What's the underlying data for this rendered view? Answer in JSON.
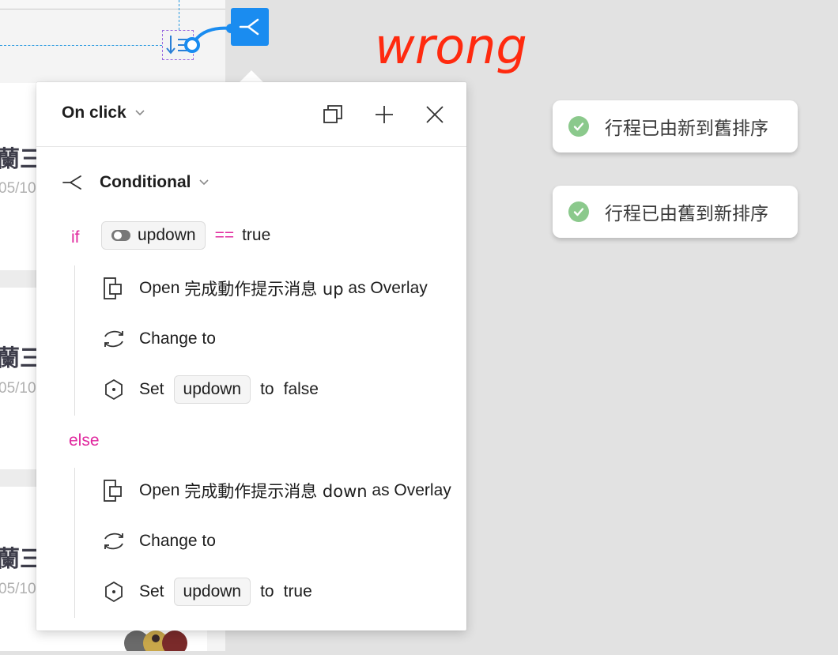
{
  "background": {
    "cards": [
      {
        "title": "蘭三",
        "date": "05/10"
      },
      {
        "title": "蘭三",
        "date": "05/10"
      },
      {
        "title": "蘭三",
        "date": "05/10"
      }
    ]
  },
  "annotation": {
    "text": "wrong",
    "color": "#ff2a0f"
  },
  "toasts": [
    {
      "icon": "check-circle-icon",
      "message": "行程已由新到舊排序"
    },
    {
      "icon": "check-circle-icon",
      "message": "行程已由舊到新排序"
    }
  ],
  "panel": {
    "trigger": "On click",
    "header_icons": [
      "duplicate-icon",
      "plus-icon",
      "close-icon"
    ],
    "conditional_label": "Conditional",
    "if_keyword": "if",
    "condition": {
      "variable": "updown",
      "operator": "==",
      "value": "true"
    },
    "if_actions": [
      {
        "icon": "overlay-icon",
        "verb": "Open",
        "target": "完成動作提示消息 up",
        "suffix": "as Overlay"
      },
      {
        "icon": "change-to-icon",
        "verb": "Change to"
      },
      {
        "icon": "variable-icon",
        "verb": "Set",
        "variable": "updown",
        "mid": "to",
        "value": "false"
      }
    ],
    "else_keyword": "else",
    "else_actions": [
      {
        "icon": "overlay-icon",
        "verb": "Open",
        "target": "完成動作提示消息 down",
        "suffix": "as Overlay"
      },
      {
        "icon": "change-to-icon",
        "verb": "Change to"
      },
      {
        "icon": "variable-icon",
        "verb": "Set",
        "variable": "updown",
        "mid": "to",
        "value": "true"
      }
    ]
  },
  "colors": {
    "accent": "#1a8cf0",
    "keyword": "#e0289e",
    "toast_check": "#8bc98c"
  }
}
